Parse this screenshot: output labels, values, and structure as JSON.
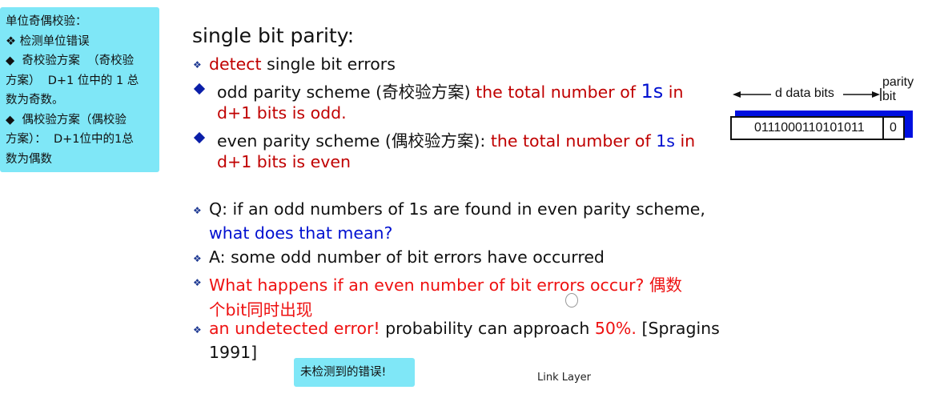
{
  "left_note": {
    "lines": [
      "单位奇偶校验：",
      "❖ 检测单位错误",
      "◆  奇校验方案  （奇校验",
      "方案）  D+1 位中的 1 总",
      "数为奇数。",
      "◆  偶校验方案（偶校验",
      "方案）：  D+1位中的1总",
      "数为偶数"
    ]
  },
  "bottom_note": "未检测到的错误!",
  "title": "single bit parity:",
  "bullets": {
    "detect_red": "detect",
    "detect_rest": " single bit errors",
    "odd_pre": "odd parity scheme (奇校验方案) ",
    "odd_red1": "the  total number of ",
    "odd_blue": "1s",
    "odd_red2": " in",
    "odd_line2": "d+1 bits is odd.",
    "even_pre": "even parity scheme (偶校验方案): ",
    "even_red1": "the  total number of ",
    "even_blue": "1s",
    "even_red2": " in",
    "even_line2": "d+1 bits is even",
    "q_line1": "Q: if an odd numbers of 1s are found  in even parity scheme,",
    "q_line2": "what does that  mean?",
    "a_line": "A: some odd number of bit errors have occurred",
    "what_line1": "What happens if an even number of  bit errors occur? 偶数",
    "what_line2": "个bit同时出现",
    "undetected_red": "an undetected error!",
    "undetected_mid": " probability can approach ",
    "undetected_pct": "50%.",
    "undetected_cite": " [Spragins",
    "undetected_line2": "1991]"
  },
  "diagram": {
    "data_bits_label": "d data bits",
    "parity_label_1": "parity",
    "parity_label_2": "bit",
    "data_bits_value": "0111000110101011",
    "parity_bit_value": "0"
  },
  "footer": "Link Layer",
  "colors": {
    "note_bg": "#7fe7f7",
    "red": "#c00000",
    "blue": "#0010d0",
    "bright_red": "#ee1111"
  }
}
